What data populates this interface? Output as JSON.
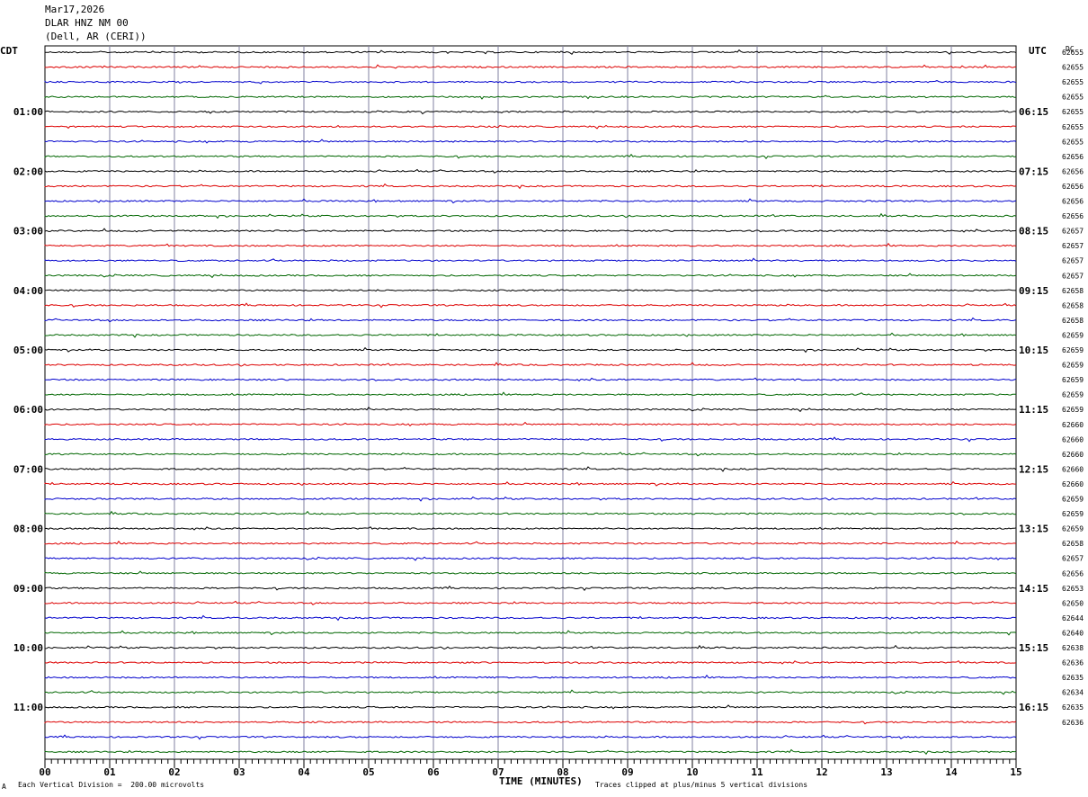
{
  "header": {
    "date": "Mar17,2026",
    "station": "DLAR HNZ NM 00",
    "location": "(Dell, AR (CERI))"
  },
  "left_timezone": "CDT",
  "right_timezone": "UTC",
  "dc_header": "DC",
  "footer": {
    "corner_mark": "A",
    "scale_note": "Each Vertical Division =  200.00 microvolts",
    "x_title": "TIME (MINUTES)",
    "clip_note": "Traces clipped at plus/minus 5 vertical divisions"
  },
  "chart_data": {
    "type": "line",
    "title": "DLAR HNZ NM 00",
    "xlabel": "TIME (MINUTES)",
    "xlim": [
      0,
      15
    ],
    "x_ticks": [
      "00",
      "01",
      "02",
      "03",
      "04",
      "05",
      "06",
      "07",
      "08",
      "09",
      "10",
      "11",
      "12",
      "13",
      "14",
      "15"
    ],
    "trace_colors": [
      "#000000",
      "#dd0000",
      "#0000cc",
      "#006600"
    ],
    "trace_count": 48,
    "left_labels": [
      "01:00",
      "02:00",
      "03:00",
      "04:00",
      "05:00",
      "06:00",
      "07:00",
      "08:00",
      "09:00",
      "10:00",
      "11:00"
    ],
    "right_labels": [
      "06:15",
      "07:15",
      "08:15",
      "09:15",
      "10:15",
      "11:15",
      "12:15",
      "13:15",
      "14:15",
      "15:15",
      "16:15"
    ],
    "dc_values": [
      62655,
      62655,
      62655,
      62655,
      62655,
      62655,
      62655,
      62656,
      62656,
      62656,
      62656,
      62656,
      62657,
      62657,
      62657,
      62657,
      62658,
      62658,
      62658,
      62659,
      62659,
      62659,
      62659,
      62659,
      62659,
      62660,
      62660,
      62660,
      62660,
      62660,
      62659,
      62659,
      62659,
      62658,
      62657,
      62656,
      62653,
      62650,
      62644,
      62640,
      62638,
      62636,
      62635,
      62634,
      62635,
      62636
    ]
  }
}
